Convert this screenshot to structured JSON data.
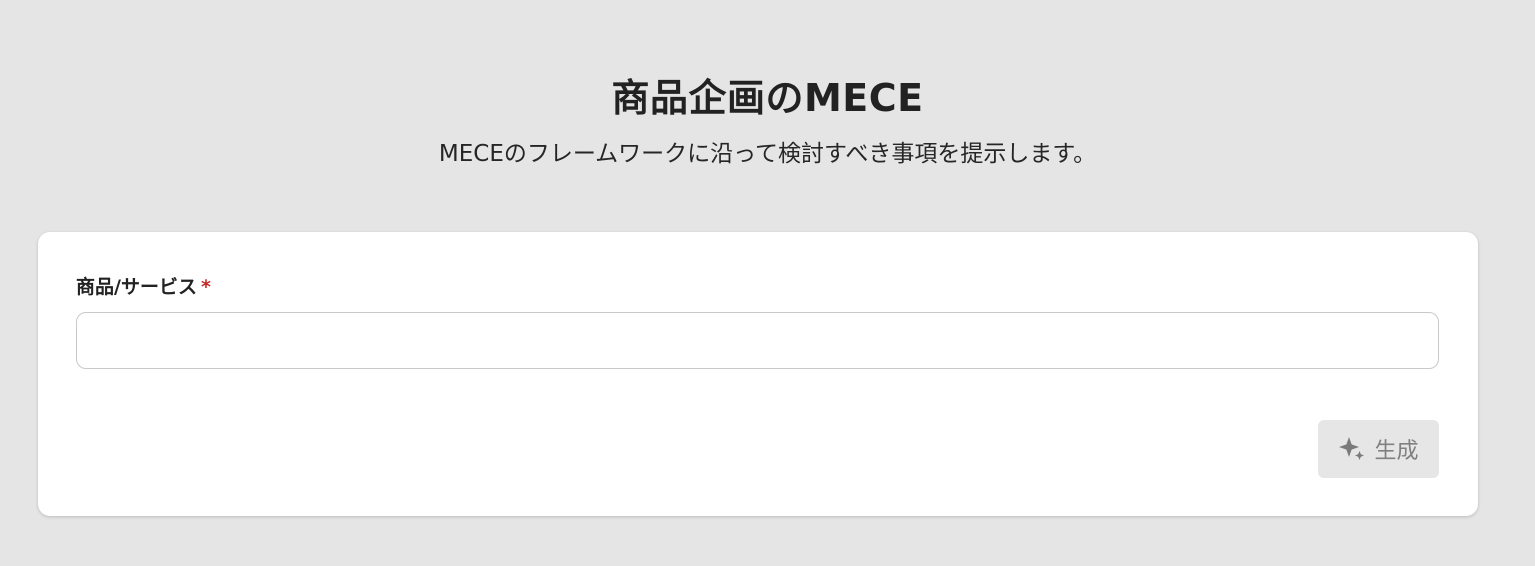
{
  "header": {
    "title": "商品企画のMECE",
    "subtitle": "MECEのフレームワークに沿って検討すべき事項を提示します。"
  },
  "form": {
    "field_label": "商品/サービス",
    "required_mark": "*",
    "input_value": "",
    "input_placeholder": "",
    "generate_label": "生成",
    "generate_icon": "sparkle-icon",
    "generate_disabled": true
  },
  "colors": {
    "background": "#e5e5e5",
    "card": "#ffffff",
    "required": "#c62828",
    "button_disabled_bg": "#e6e6e6",
    "button_disabled_text": "#808080"
  }
}
